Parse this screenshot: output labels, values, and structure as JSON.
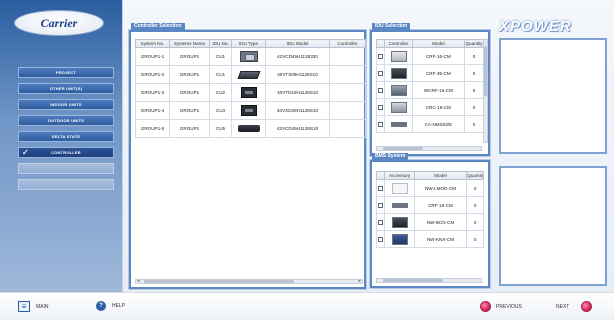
{
  "brand": {
    "logo_text": "Carrier",
    "product_text": "XPOWER"
  },
  "nav": {
    "items": [
      {
        "label": "PROJECT",
        "state": "normal"
      },
      {
        "label": "OTHER UNIT(S)",
        "state": "normal"
      },
      {
        "label": "INDOOR UNITS",
        "state": "normal"
      },
      {
        "label": "OUTDOOR UNITS",
        "state": "normal"
      },
      {
        "label": "DELTA STATE",
        "state": "normal"
      },
      {
        "label": "CONTROLLER",
        "state": "active"
      },
      {
        "label": "",
        "state": "disabled"
      },
      {
        "label": "",
        "state": "disabled"
      }
    ]
  },
  "controller_panel": {
    "title": "Controller Selection",
    "columns": [
      "System No.",
      "Systems Name",
      "IDU No.",
      "IDU Type",
      "IDU Model",
      "Controller"
    ],
    "rows": [
      {
        "system_no": "GROUP1-1",
        "system_name": "GROUP1",
        "idu_no": "CU1",
        "idu_type_icon": "cassette-unit",
        "idu_model": "42VCD45H1128330"
      },
      {
        "system_no": "GROUP1-2",
        "system_name": "GROUP1",
        "idu_no": "CU1",
        "idu_type_icon": "duct-unit",
        "idu_model": "40VTS09H1128S10"
      },
      {
        "system_no": "GROUP1-3",
        "system_name": "GROUP1",
        "idu_no": "CU2",
        "idu_type_icon": "cassette-dark-unit",
        "idu_model": "40VTD18H1128S10"
      },
      {
        "system_no": "GROUP1-4",
        "system_name": "GROUP1",
        "idu_no": "CU3",
        "idu_type_icon": "cassette-dark-unit",
        "idu_model": "40VXD28H1128S10"
      },
      {
        "system_no": "GROUP1-5",
        "system_name": "GROUP1",
        "idu_no": "CU5",
        "idu_type_icon": "wall-unit",
        "idu_model": "42VCD45H1128S10"
      }
    ]
  },
  "idu_panel": {
    "title": "IDU Selection",
    "columns": [
      "Controller",
      "Model",
      "Quantity"
    ],
    "rows": [
      {
        "image": "wall-controller",
        "model": "CRF-16-CM",
        "qty": "0"
      },
      {
        "image": "wall-controller-dark",
        "model": "CRF-35-CM",
        "qty": "0"
      },
      {
        "image": "panel-controller",
        "model": "WCRF-16-CM",
        "qty": "0"
      },
      {
        "image": "grey-controller",
        "model": "CRC-16-CM",
        "qty": "0"
      },
      {
        "image": "strip-controller",
        "model": "CA-NMS03/E",
        "qty": "0"
      }
    ]
  },
  "bms_panel": {
    "title": "BMS System",
    "columns": [
      "Accessory",
      "Model",
      "Quantity"
    ],
    "rows": [
      {
        "image": "white-box",
        "model": "NW-LMOD-CM",
        "qty": "0"
      },
      {
        "image": "strip-device",
        "model": "CRF-16-CM",
        "qty": "0"
      },
      {
        "image": "dark-gateway",
        "model": "NW-BCN-CM",
        "qty": "0"
      },
      {
        "image": "blue-module",
        "model": "NW-KNX-CM",
        "qty": "0"
      }
    ]
  },
  "bottom_bar": {
    "main_label": "MAIN",
    "help_label": "HELP",
    "previous_label": "PREVIOUS",
    "next_label": "NEXT"
  },
  "colors": {
    "accent": "#5b87c5",
    "nav_bg": "#2f5c9f",
    "nav_button_red": "#d42a5c"
  }
}
